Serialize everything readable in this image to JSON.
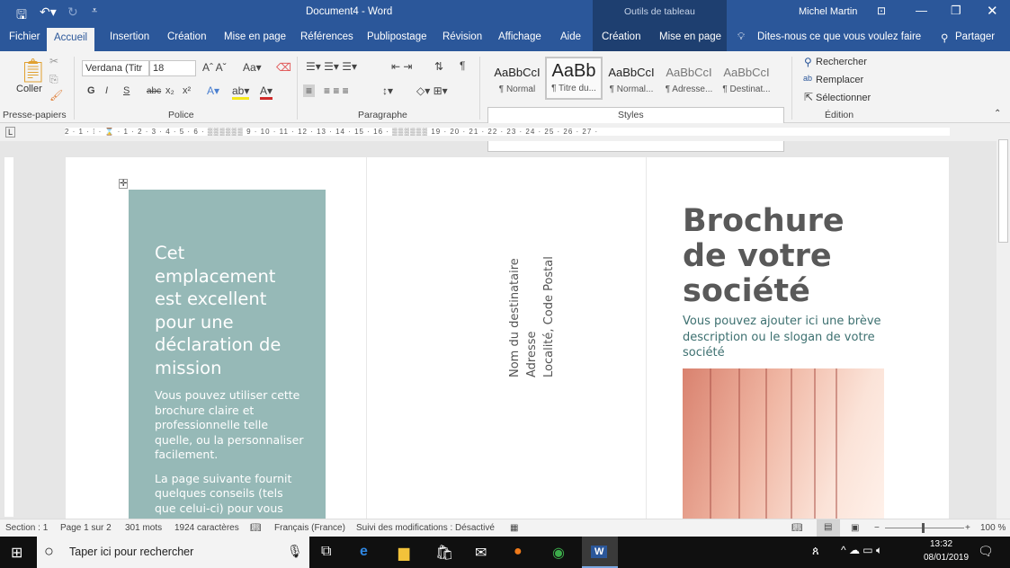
{
  "titlebar": {
    "title": "Document4  -  Word",
    "context": "Outils de tableau",
    "user": "Michel Martin"
  },
  "tabs": [
    "Fichier",
    "Accueil",
    "Insertion",
    "Création",
    "Mise en page",
    "Références",
    "Publipostage",
    "Révision",
    "Affichage",
    "Aide",
    "Création",
    "Mise en page"
  ],
  "tell_me": "Dites-nous ce que vous voulez faire",
  "share": "Partager",
  "ribbon": {
    "clipboard": {
      "paste": "Coller",
      "group": "Presse-papiers"
    },
    "font": {
      "name": "Verdana (Titr",
      "size": "18",
      "group": "Police",
      "bold": "G",
      "italic": "I",
      "underline": "S",
      "strike": "abc",
      "sub": "x₂",
      "sup": "x²"
    },
    "paragraph": {
      "group": "Paragraphe"
    },
    "styles": {
      "group": "Styles",
      "items": [
        {
          "preview": "AaBbCcI",
          "name": "¶ Normal"
        },
        {
          "preview": "AaBb",
          "name": "¶ Titre du..."
        },
        {
          "preview": "AaBbCcI",
          "name": "¶ Normal..."
        },
        {
          "preview": "AaBbCcI",
          "name": "¶ Adresse..."
        },
        {
          "preview": "AaBbCcI",
          "name": "¶ Destinat..."
        }
      ]
    },
    "editing": {
      "group": "Édition",
      "find": "Rechercher",
      "replace": "Remplacer",
      "select": "Sélectionner"
    }
  },
  "ruler": "2 · 1 · ⁞ · ⌛ · 1 · 2 · 3 · 4 · 5 · 6 · ▒▒▒▒▒▒ 9 · 10 · 11 · 12 · 13 · 14 · 15 · 16 · ▒▒▒▒▒▒ 19 · 20 · 21 · 22 · 23 · 24 · 25 · 26 · 27 ·",
  "document": {
    "mission_heading": "Cet emplacement est excellent pour une déclaration de mission",
    "mission_p1": "Vous pouvez utiliser cette brochure claire et professionnelle telle quelle, ou la personnaliser facilement.",
    "mission_p2": "La page suivante fournit quelques conseils (tels que celui-ci) pour vous",
    "address": [
      "Nom du destinataire",
      "Adresse",
      "Localité, Code Postal"
    ],
    "title": "Brochure de votre société",
    "description": "Vous pouvez ajouter ici une brève description ou le slogan de votre société"
  },
  "status": {
    "section": "Section : 1",
    "page": "Page 1 sur 2",
    "words": "301 mots",
    "chars": "1924 caractères",
    "language": "Français (France)",
    "track": "Suivi des modifications : Désactivé",
    "zoom": "100 %",
    "zoom_percent": 100
  },
  "taskbar": {
    "search": "Taper ici pour rechercher",
    "time": "13:32",
    "date": "08/01/2019"
  },
  "colors": {
    "brand": "#2b579a",
    "teal": "#96b9b7"
  }
}
